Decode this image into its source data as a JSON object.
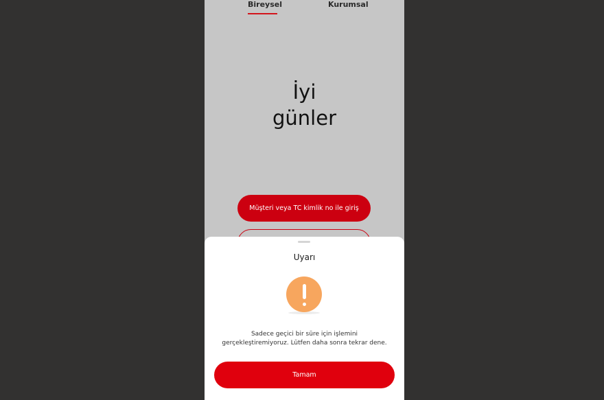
{
  "tabs": {
    "bireysel": "Bireysel",
    "kurumsal": "Kurumsal",
    "active": "bireysel"
  },
  "greeting": {
    "line1": "İyi",
    "line2": "günler"
  },
  "login_button": "Müşteri veya TC kimlik no ile giriş",
  "dialog": {
    "title": "Uyarı",
    "icon": "exclamation-icon",
    "message_line1": "Sadece geçici bir süre için işlemini",
    "message_line2": "gerçekleştiremiyoruz. Lütfen daha sonra tekrar dene.",
    "ok_button": "Tamam"
  },
  "colors": {
    "brand_red": "#cc0010",
    "warning_orange": "#f7a65e",
    "backdrop": "#323130"
  }
}
